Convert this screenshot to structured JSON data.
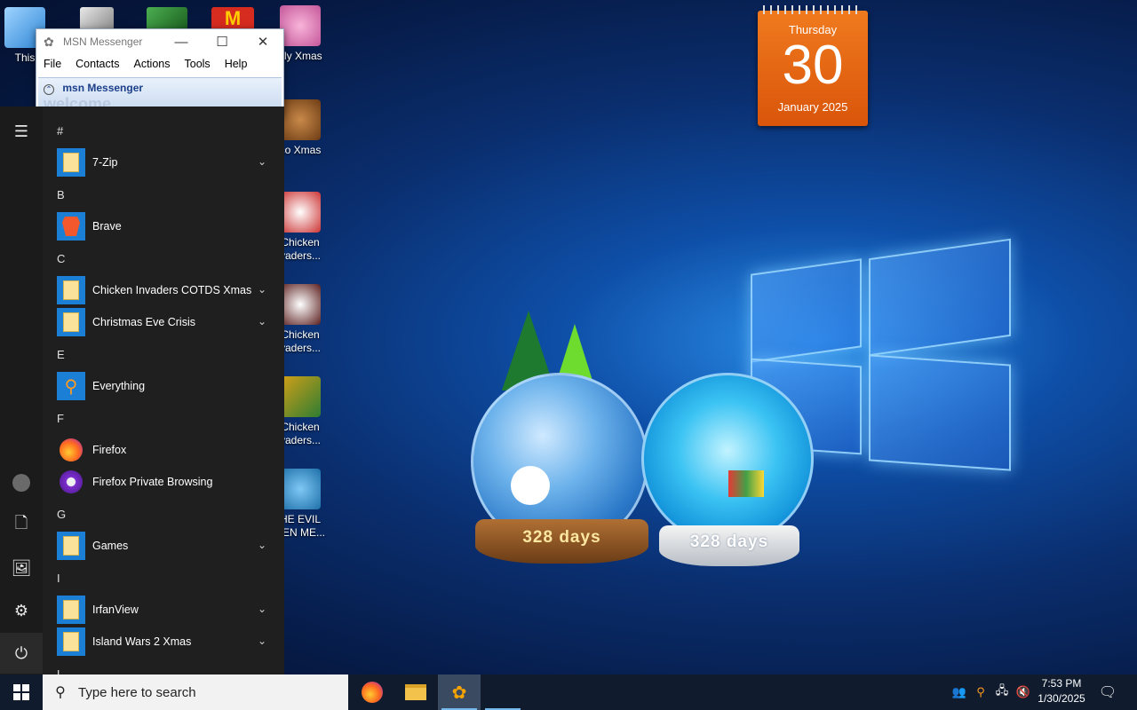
{
  "desktop": {
    "icons": [
      {
        "label": "This"
      },
      {
        "label": "gly Xmas"
      },
      {
        "label": "co Xmas"
      },
      {
        "label": "Chicken",
        "label2": "vaders..."
      },
      {
        "label": "Chicken",
        "label2": "vaders..."
      },
      {
        "label": "Chicken",
        "label2": "vaders..."
      },
      {
        "label": "HE EVIL",
        "label2": "EEN ME..."
      }
    ],
    "calendar": {
      "weekday": "Thursday",
      "day": "30",
      "month_year": "January 2025"
    },
    "globes": [
      {
        "label": "328 days"
      },
      {
        "label": "328 days"
      }
    ]
  },
  "msn": {
    "title": "MSN Messenger",
    "menu": [
      "File",
      "Contacts",
      "Actions",
      "Tools",
      "Help"
    ],
    "brand": "msn Messenger",
    "welcome": "welcome"
  },
  "start_menu": {
    "sections": [
      {
        "letter": "#",
        "apps": [
          {
            "name": "7-Zip",
            "icon": "folder",
            "expandable": true
          }
        ]
      },
      {
        "letter": "B",
        "apps": [
          {
            "name": "Brave",
            "icon": "brave",
            "expandable": false
          }
        ]
      },
      {
        "letter": "C",
        "apps": [
          {
            "name": "Chicken Invaders COTDS Xmas",
            "icon": "folder",
            "expandable": true
          },
          {
            "name": "Christmas Eve Crisis",
            "icon": "folder",
            "expandable": true
          }
        ]
      },
      {
        "letter": "E",
        "apps": [
          {
            "name": "Everything",
            "icon": "everything",
            "expandable": false
          }
        ]
      },
      {
        "letter": "F",
        "apps": [
          {
            "name": "Firefox",
            "icon": "firefox",
            "expandable": false
          },
          {
            "name": "Firefox Private Browsing",
            "icon": "firefox-private",
            "expandable": false
          }
        ]
      },
      {
        "letter": "G",
        "apps": [
          {
            "name": "Games",
            "icon": "folder",
            "expandable": true
          }
        ]
      },
      {
        "letter": "I",
        "apps": [
          {
            "name": "IrfanView",
            "icon": "folder",
            "expandable": true
          },
          {
            "name": "Island Wars 2 Xmas",
            "icon": "folder",
            "expandable": true
          }
        ]
      },
      {
        "letter": "L",
        "apps": []
      }
    ]
  },
  "taskbar": {
    "search_placeholder": "Type here to search",
    "time": "7:53 PM",
    "date": "1/30/2025"
  },
  "colors": {
    "accent": "#1c7fd6",
    "calendar": "#e8650f",
    "taskbar": "#101c2e",
    "start_bg": "#1f1f1f"
  }
}
